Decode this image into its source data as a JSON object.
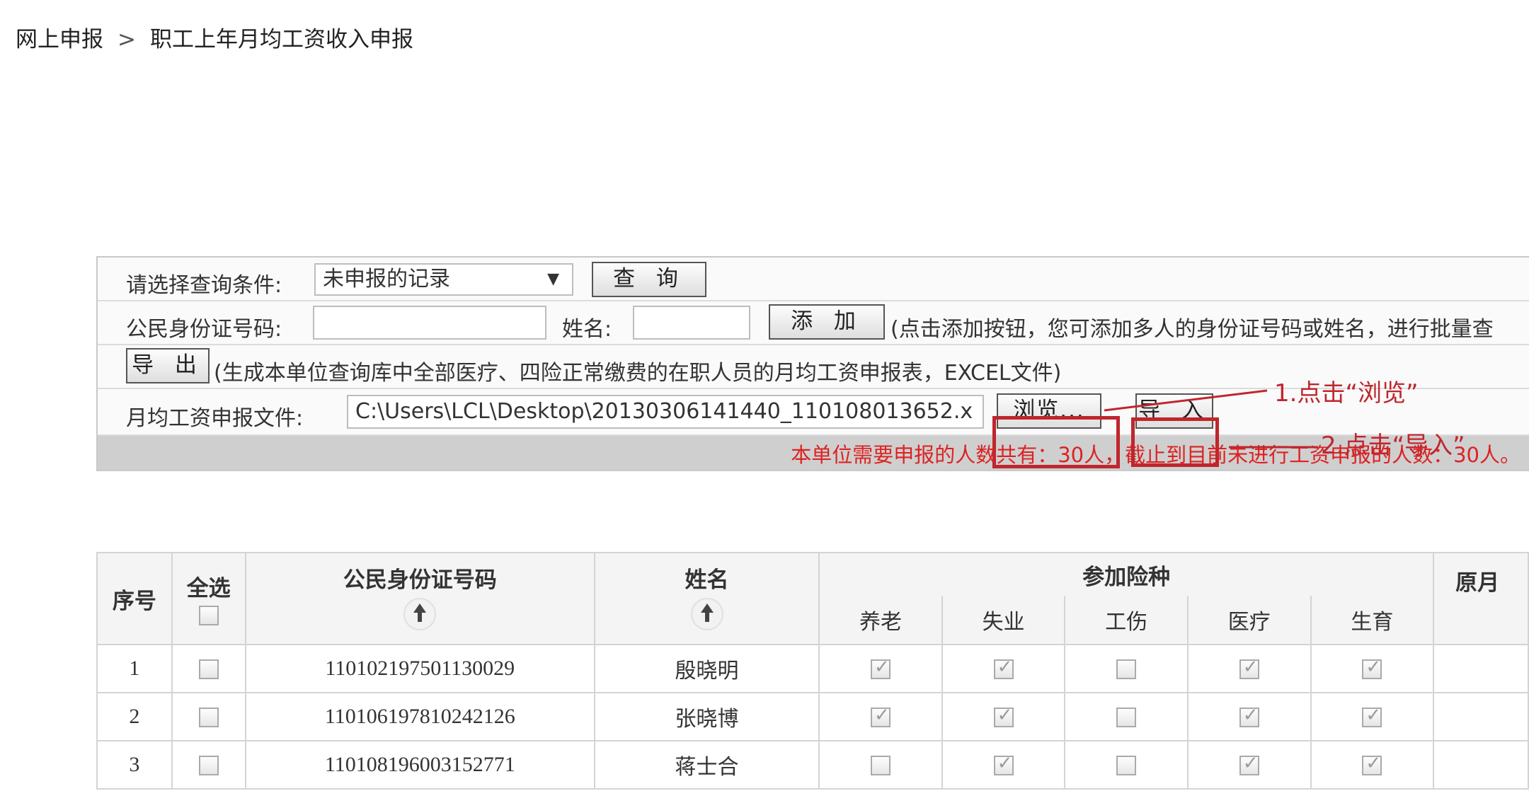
{
  "breadcrumb": {
    "root": "网上申报",
    "separator": ">",
    "current": "职工上年月均工资收入申报"
  },
  "query": {
    "label": "请选择查询条件:",
    "select_value": "未申报的记录",
    "button": "查 询"
  },
  "add_row": {
    "id_label": "公民身份证号码:",
    "id_value": "",
    "name_label": "姓名:",
    "name_value": "",
    "button": "添 加",
    "hint": "(点击添加按钮，您可添加多人的身份证号码或姓名，进行批量查"
  },
  "export_row": {
    "button": "导 出",
    "hint": "(生成本单位查询库中全部医疗、四险正常缴费的在职人员的月均工资申报表，EXCEL文件)"
  },
  "file_row": {
    "label": "月均工资申报文件:",
    "path": "C:\\Users\\LCL\\Desktop\\20130306141440_110108013652.x",
    "browse_button": "浏览...",
    "import_button": "导 入"
  },
  "annotations": {
    "step1": "1.点击“浏览”",
    "step2": "2.点击“导入”",
    "color": "#c0262d"
  },
  "status_text": "本单位需要申报的人数共有：30人，截止到目前未进行工资申报的人数：30人。",
  "table": {
    "headers": {
      "index": "序号",
      "select_all": "全选",
      "id": "公民身份证号码",
      "name": "姓名",
      "insurance": "参加险种",
      "original": "原月"
    },
    "insurance_types": [
      "养老",
      "失业",
      "工伤",
      "医疗",
      "生育"
    ],
    "rows": [
      {
        "index": "1",
        "id": "110102197501130029",
        "name": "殷晓明",
        "insurance": [
          true,
          true,
          false,
          true,
          true
        ]
      },
      {
        "index": "2",
        "id": "110106197810242126",
        "name": "张晓博",
        "insurance": [
          true,
          true,
          false,
          true,
          true
        ]
      },
      {
        "index": "3",
        "id": "110108196003152771",
        "name": "蒋士合",
        "insurance": [
          false,
          true,
          false,
          true,
          true
        ]
      }
    ]
  }
}
